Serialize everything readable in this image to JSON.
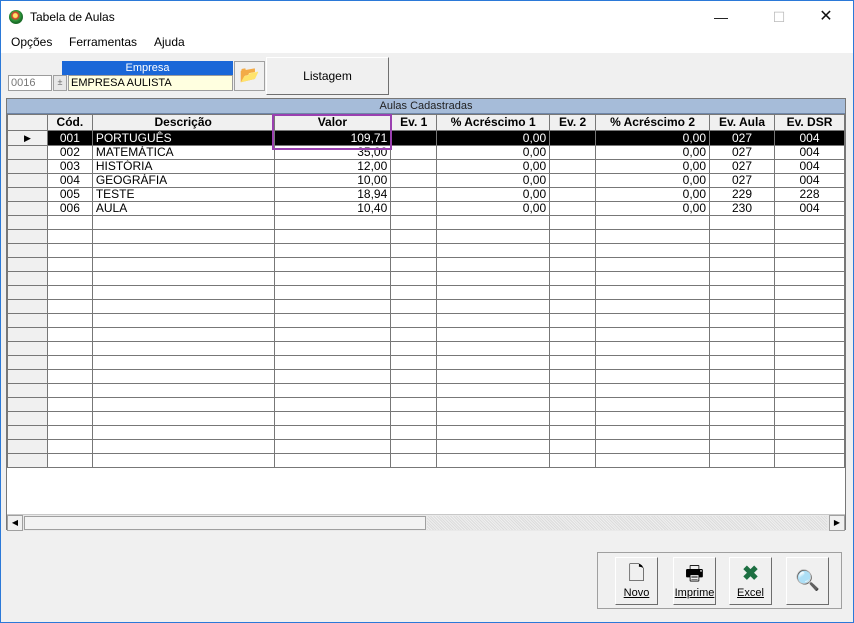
{
  "window": {
    "title": "Tabela de Aulas",
    "min": "—",
    "max": "☐",
    "close": "✕"
  },
  "menu": [
    "Opções",
    "Ferramentas",
    "Ajuda"
  ],
  "empresa": {
    "label": "Empresa",
    "code": "0016",
    "name": "EMPRESA AULISTA"
  },
  "buttons": {
    "listagem": "Listagem",
    "novo": "Novo",
    "imprime": "Imprime",
    "excel": "Excel"
  },
  "grid": {
    "caption": "Aulas Cadastradas",
    "columns": [
      "Cód.",
      "Descrição",
      "Valor",
      "Ev. 1",
      "% Acréscimo 1",
      "Ev. 2",
      "% Acréscimo 2",
      "Ev. Aula",
      "Ev. DSR"
    ],
    "rows": [
      [
        "001",
        "PORTUGUÊS",
        "109,71",
        "",
        "0,00",
        "",
        "0,00",
        "027",
        "004"
      ],
      [
        "002",
        "MATEMÁTICA",
        "35,00",
        "",
        "0,00",
        "",
        "0,00",
        "027",
        "004"
      ],
      [
        "003",
        "HISTÓRIA",
        "12,00",
        "",
        "0,00",
        "",
        "0,00",
        "027",
        "004"
      ],
      [
        "004",
        "GEOGRÁFIA",
        "10,00",
        "",
        "0,00",
        "",
        "0,00",
        "027",
        "004"
      ],
      [
        "005",
        "TESTE",
        "18,94",
        "",
        "0,00",
        "",
        "0,00",
        "229",
        "228"
      ],
      [
        "006",
        "AULA",
        "10,40",
        "",
        "0,00",
        "",
        "0,00",
        "230",
        "004"
      ]
    ],
    "selected_row": 0,
    "empty_rows": 18
  },
  "icons": {
    "app": "app-icon",
    "folder": "folder-open-icon",
    "novo": "new-document-icon",
    "imprime": "printer-icon",
    "excel": "excel-icon",
    "search": "magnifier-icon",
    "row_indicator": "current-row-arrow-icon"
  }
}
